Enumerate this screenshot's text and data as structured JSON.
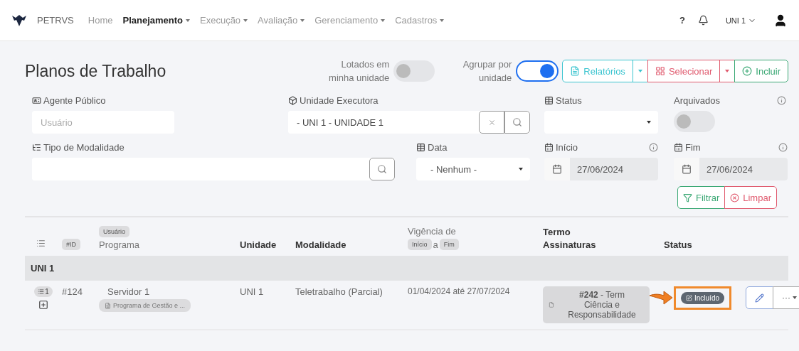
{
  "navbar": {
    "brand": "PETRVS",
    "menu": [
      {
        "label": "Home",
        "selected": false,
        "dropdown": false
      },
      {
        "label": "Planejamento",
        "selected": true,
        "dropdown": true
      },
      {
        "label": "Execução",
        "selected": false,
        "dropdown": true
      },
      {
        "label": "Avaliação",
        "selected": false,
        "dropdown": true
      },
      {
        "label": "Gerenciamento",
        "selected": false,
        "dropdown": true
      },
      {
        "label": "Cadastros",
        "selected": false,
        "dropdown": true
      }
    ],
    "help": "?",
    "unit": "UNI 1"
  },
  "page": {
    "title": "Planos de Trabalho"
  },
  "toggles": [
    {
      "label": "Lotados em minha unidade",
      "on": false
    },
    {
      "label": "Agrupar por unidade",
      "on": true
    }
  ],
  "actions": [
    {
      "label": "Relatórios",
      "kind": "report",
      "dropdown": true
    },
    {
      "label": "Selecionar",
      "kind": "select",
      "dropdown": true
    },
    {
      "label": "Incluir",
      "kind": "add",
      "dropdown": false
    }
  ],
  "filters": [
    [
      {
        "kind": "text",
        "label": "Agente Público",
        "placeholder": "Usuário",
        "info": false
      },
      {
        "kind": "search",
        "label": "Unidade Executora",
        "value": "- UNI 1 - UNIDADE 1",
        "clearable": true,
        "info": false
      },
      {
        "kind": "select",
        "label": "Status",
        "info": false
      },
      {
        "kind": "toggle",
        "label": "Arquivados",
        "on": false,
        "info": true
      }
    ],
    [
      {
        "kind": "search",
        "label": "Tipo de Modalidade",
        "clearable": false,
        "info": false
      },
      {
        "kind": "select",
        "label": "Data",
        "value": "- Nenhum -",
        "info": false
      },
      {
        "kind": "date",
        "label": "Início",
        "value": "27/06/2024",
        "info": true
      },
      {
        "kind": "date",
        "label": "Fim",
        "value": "27/06/2024",
        "info": true
      }
    ]
  ],
  "filter_buttons": [
    {
      "label": "Filtrar",
      "kind": "filter"
    },
    {
      "label": "Limpar",
      "kind": "clear"
    }
  ],
  "table": {
    "columns": {
      "id": "#ID",
      "user": "Usuário",
      "program": "Programa",
      "unit": "Unidade",
      "modality": "Modalidade",
      "period": "Vigência de",
      "start": "Início",
      "sep": "a",
      "end": "Fim",
      "term": "Termo",
      "signatures": "Assinaturas",
      "status": "Status"
    },
    "groups": [
      {
        "label": "UNI 1",
        "rows": [
          {
            "count": "1",
            "id": "#124",
            "user": "Servidor 1",
            "program": "Programa de Gestão e ...",
            "unit": "UNI 1",
            "modality": "Teletrabalho (Parcial)",
            "period": "01/04/2024 até 27/07/2024",
            "term_number": "#242",
            "term_text": "- Term",
            "term_rest": "Ciência e Responsabilidade",
            "status": "Incluído",
            "highlighted": true,
            "more": "···"
          }
        ]
      }
    ]
  }
}
